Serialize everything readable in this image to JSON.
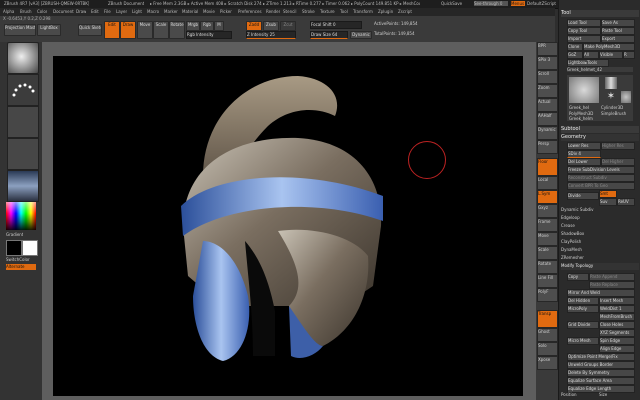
{
  "titlebar": {
    "app_title": "ZBrush 4R7 [vA3] [ZBRUSH-QMEW-0RTBK]",
    "document": "ZBrush Document",
    "stats": "▸ Free Mem 2.3GB ▸ Active Mem 408 ▸ Scratch Disk 274 ▸ ZTime 1.213 ▸ RTime 0.277 ▸ Timer 0.062 ▸ PolyCount 149.851 KP ▸ MeshCount 1",
    "quicksave": "QuickSave",
    "seethrough": "See-through 0",
    "menus_label": "Menus",
    "script_label": "DefaultZScript"
  },
  "menubar": {
    "items": [
      "Alpha",
      "Brush",
      "Color",
      "Document",
      "Draw",
      "Edit",
      "File",
      "Layer",
      "Light",
      "Macro",
      "Marker",
      "Material",
      "Movie",
      "Picker",
      "Preferences",
      "Render",
      "Stencil",
      "Stroke",
      "Texture",
      "Tool",
      "Transform",
      "Zplugin",
      "Zscript"
    ]
  },
  "topshelf": {
    "projection_master": "Projection Master",
    "lightbox": "LightBox",
    "quick_sketch": "Quick Sketch",
    "edit": "Edit",
    "draw": "Draw",
    "move": "Move",
    "scale": "Scale",
    "rotate": "Rotate",
    "mrgb": "Mrgb",
    "rgb": "Rgb",
    "m": "M",
    "rgb_intensity": "Rgb Intensity",
    "zadd": "Zadd",
    "zsub": "Zsub",
    "zcut": "Zcut",
    "z_intensity": "Z Intensity 25",
    "focal_shift": "Focal Shift 0",
    "draw_size": "Draw Size 64",
    "dynamic": "Dynamic",
    "active_points": "ActivePoints: 149,854",
    "total_points": "TotalPoints: 149,854",
    "coords": "X -0.6453,Y 0.2,Z 0.298"
  },
  "lefttray": {
    "gradient": "Gradient",
    "switch_color": "SwitchColor",
    "alternate": "Alternate"
  },
  "toolpalette": {
    "title": "Tool",
    "load_tool": "Load Tool",
    "save_as": "Save As",
    "copy_tool": "Copy Tool",
    "paste_tool": "Paste Tool",
    "import": "Import",
    "export": "Export",
    "clone": "Clone",
    "make_polymesh": "Make PolyMesh3D",
    "goz": "GoZ",
    "all": "All",
    "visible": "Visible",
    "r": "R",
    "lightbox_tools": "Lightbox▸Tools",
    "greek_helmet": "Greek_helmet_42",
    "tool_labels": [
      "Greek_hel",
      "Cylinder3D",
      "PolyMesh3D",
      "SimpleBrush",
      "Greek_helm"
    ],
    "subtool": "Subtool",
    "geometry": "Geometry",
    "lower_res": "Lower Res",
    "higher_res": "Higher Res",
    "sdiv": "SDiv 4",
    "del_lower": "Del Lower",
    "del_higher": "Del Higher",
    "freeze_subdiv": "Freeze SubDivision Levels",
    "reconstruct_subdiv": "Reconstruct Subdiv",
    "convert_bpr": "Convert BPR To Geo",
    "divide": "Divide",
    "smt": "Smt",
    "suv": "Suv",
    "relaxuv": "ReUV",
    "sections": [
      "Dynamic Subdiv",
      "Edgeloop",
      "Crease",
      "ShadowBox",
      "ClayPolish",
      "DynaMesh",
      "ZRemesher",
      "Modify Topology"
    ],
    "copy": "Copy",
    "paste_append": "Paste Append",
    "paste_replace": "Paste Replace",
    "mirror_and_weld": "Mirror And Weld",
    "del_hidden": "Del Hidden",
    "insert_mesh": "Insert Mesh",
    "micro_poly": "MicroPoly",
    "weld_dist": "WeldDist 1",
    "mesh_from_brush": "MeshFromBrush",
    "close_holes": "Close Holes",
    "grid_divide": "Grid Divide",
    "xyz_segments": "XYZ Segments",
    "micro_mesh": "Micro Mesh",
    "spin_edge": "Spin Edge",
    "align_edge": "Align Edge",
    "optimize_points": "Optimize Point Merge/Fix",
    "unweld_groups": "Unweld Groups Border",
    "delete_by_symmetry": "Delete By Symmetry",
    "equalize_surface": "Equalize Surface Area",
    "equalize_edge": "Equalize Edge Length",
    "position": "Position",
    "size": "Size"
  },
  "rightshelf": {
    "labels": [
      "BPR",
      "SPix 3",
      "Scroll",
      "Zoom",
      "Actual",
      "AAHalf",
      "Dynamic",
      "Persp",
      "Floor",
      "Local",
      "L.Sym",
      "Gxyz",
      "Frame",
      "Move",
      "Scale",
      "Rotate",
      "Line Fill",
      "PolyF",
      "Transp",
      "Ghost",
      "Solo",
      "Xpose"
    ]
  },
  "colors": {
    "accent": "#e06a10",
    "canvas_bg": "#000000",
    "panel_bg": "#2b2b2b"
  }
}
